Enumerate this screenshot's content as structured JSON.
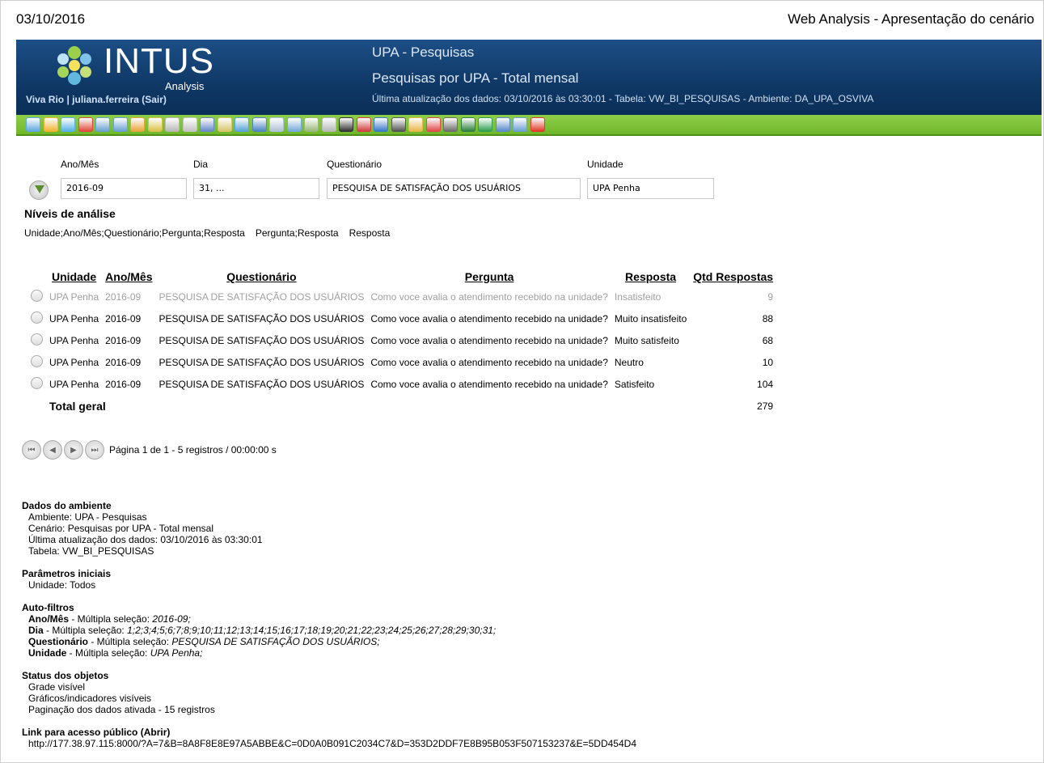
{
  "date": "03/10/2016",
  "page_title": "Web Analysis - Apresentação do cenário",
  "header": {
    "logo_text": "INTUS",
    "logo_sub": "Analysis",
    "user_prefix": "Viva Rio | juliana.ferreira (",
    "logout_label": "Sair",
    "user_suffix": ")",
    "title1": "UPA - Pesquisas",
    "title2": "Pesquisas por UPA - Total mensal",
    "subtitle": "Última atualização dos dados: 03/10/2016 às 03:30:01 - Tabela: VW_BI_PESQUISAS - Ambiente: DA_UPA_OSVIVA"
  },
  "toolbar_icons": [
    {
      "name": "home-icon",
      "color": "#5fa8e0"
    },
    {
      "name": "refresh-icon",
      "color": "#f2b233"
    },
    {
      "name": "reload-icon",
      "color": "#58b0e8"
    },
    {
      "name": "pin-icon",
      "color": "#e04a3a"
    },
    {
      "name": "presentation-icon",
      "color": "#6aa0d0"
    },
    {
      "name": "presentation-edit-icon",
      "color": "#6aa0d0"
    },
    {
      "name": "filter-edit-icon",
      "color": "#e7a63b"
    },
    {
      "name": "filter-icon",
      "color": "#d9c04a"
    },
    {
      "name": "filter-remove-icon",
      "color": "#b8b8b8"
    },
    {
      "name": "link-icon",
      "color": "#c3c3c3"
    },
    {
      "name": "spellcheck-icon",
      "color": "#6a89c9"
    },
    {
      "name": "columns-icon",
      "color": "#d6c56a"
    },
    {
      "name": "grid-icon",
      "color": "#59a3d8"
    },
    {
      "name": "table-icon",
      "color": "#4d84c4"
    },
    {
      "name": "sum-icon",
      "color": "#b0c0d8"
    },
    {
      "name": "window-icon",
      "color": "#78a9d8"
    },
    {
      "name": "layout-icon",
      "color": "#9ab87a"
    },
    {
      "name": "bar-small-icon",
      "color": "#b7b7b7"
    },
    {
      "name": "fx-icon",
      "color": "#333333"
    },
    {
      "name": "chart-bar-icon",
      "color": "#d04040"
    },
    {
      "name": "chart-line-icon",
      "color": "#3a78c8"
    },
    {
      "name": "gauge-icon",
      "color": "#555555"
    },
    {
      "name": "traffic-icon",
      "color": "#e9b64a"
    },
    {
      "name": "indicator-icon",
      "color": "#e04a4a"
    },
    {
      "name": "print-icon",
      "color": "#6d6d6d"
    },
    {
      "name": "export-icon",
      "color": "#2f7f3f"
    },
    {
      "name": "export-excel-icon",
      "color": "#2f9f4f"
    },
    {
      "name": "save-icon",
      "color": "#5a8ac8"
    },
    {
      "name": "new-window-icon",
      "color": "#6aa0d0"
    },
    {
      "name": "close-icon",
      "color": "#e03a2a"
    }
  ],
  "filters": [
    {
      "label": "Ano/Mês",
      "value": "2016-09"
    },
    {
      "label": "Dia",
      "value": "31, ..."
    },
    {
      "label": "Questionário",
      "value": "PESQUISA DE SATISFAÇÃO DOS USUÁRIOS"
    },
    {
      "label": "Unidade",
      "value": "UPA Penha"
    }
  ],
  "niveis": {
    "title": "Níveis de análise",
    "links": [
      "Unidade;Ano/Mês;Questionário;Pergunta;Resposta",
      "Pergunta;Resposta",
      "Resposta"
    ]
  },
  "grid": {
    "headers": [
      "Unidade",
      "Ano/Mês",
      "Questionário",
      "Pergunta",
      "Resposta",
      "Qtd Respostas"
    ],
    "rows": [
      [
        "UPA Penha",
        "2016-09",
        "PESQUISA DE SATISFAÇÃO DOS USUÁRIOS",
        "Como voce avalia o atendimento recebido na unidade?",
        "Insatisfeito",
        "9"
      ],
      [
        "UPA Penha",
        "2016-09",
        "PESQUISA DE SATISFAÇÃO DOS USUÁRIOS",
        "Como voce avalia o atendimento recebido na unidade?",
        "Muito insatisfeito",
        "88"
      ],
      [
        "UPA Penha",
        "2016-09",
        "PESQUISA DE SATISFAÇÃO DOS USUÁRIOS",
        "Como voce avalia o atendimento recebido na unidade?",
        "Muito satisfeito",
        "68"
      ],
      [
        "UPA Penha",
        "2016-09",
        "PESQUISA DE SATISFAÇÃO DOS USUÁRIOS",
        "Como voce avalia o atendimento recebido na unidade?",
        "Neutro",
        "10"
      ],
      [
        "UPA Penha",
        "2016-09",
        "PESQUISA DE SATISFAÇÃO DOS USUÁRIOS",
        "Como voce avalia o atendimento recebido na unidade?",
        "Satisfeito",
        "104"
      ]
    ],
    "total_label": "Total geral",
    "total_value": "279"
  },
  "pager": {
    "text": "Página 1 de 1 - 5 registros / 00:00:00 s"
  },
  "info": {
    "env_title": "Dados do ambiente",
    "env_lines": [
      "Ambiente: UPA - Pesquisas",
      "Cenário: Pesquisas por UPA - Total mensal",
      "Última atualização dos dados: 03/10/2016 às 03:30:01",
      "Tabela: VW_BI_PESQUISAS"
    ],
    "params_title": "Parâmetros iniciais",
    "params_lines": [
      "Unidade: Todos"
    ],
    "auto_title": "Auto-filtros",
    "auto": [
      {
        "field": "Ano/Mês",
        "mode": " - Múltipla seleção: ",
        "values": "2016-09;"
      },
      {
        "field": "Dia",
        "mode": " - Múltipla seleção: ",
        "values": "1;2;3;4;5;6;7;8;9;10;11;12;13;14;15;16;17;18;19;20;21;22;23;24;25;26;27;28;29;30;31;"
      },
      {
        "field": "Questionário",
        "mode": " - Múltipla seleção: ",
        "values": "PESQUISA DE SATISFAÇÃO DOS USUÁRIOS;"
      },
      {
        "field": "Unidade",
        "mode": " - Múltipla seleção: ",
        "values": "UPA Penha;"
      }
    ],
    "status_title": "Status dos objetos",
    "status_lines": [
      "Grade visível",
      "Gráficos/indicadores visíveis",
      "Paginação dos dados ativada - 15 registros"
    ],
    "link_title_prefix": "Link para acesso público (",
    "link_open_label": "Abrir",
    "link_title_suffix": ")",
    "link_url": "http://177.38.97.115:8000/?A=7&B=8A8F8E8E97A5ABBE&C=0D0A0B091C2034C7&D=353D2DDF7E8B95B053F507153237&E=5DD454D4"
  }
}
